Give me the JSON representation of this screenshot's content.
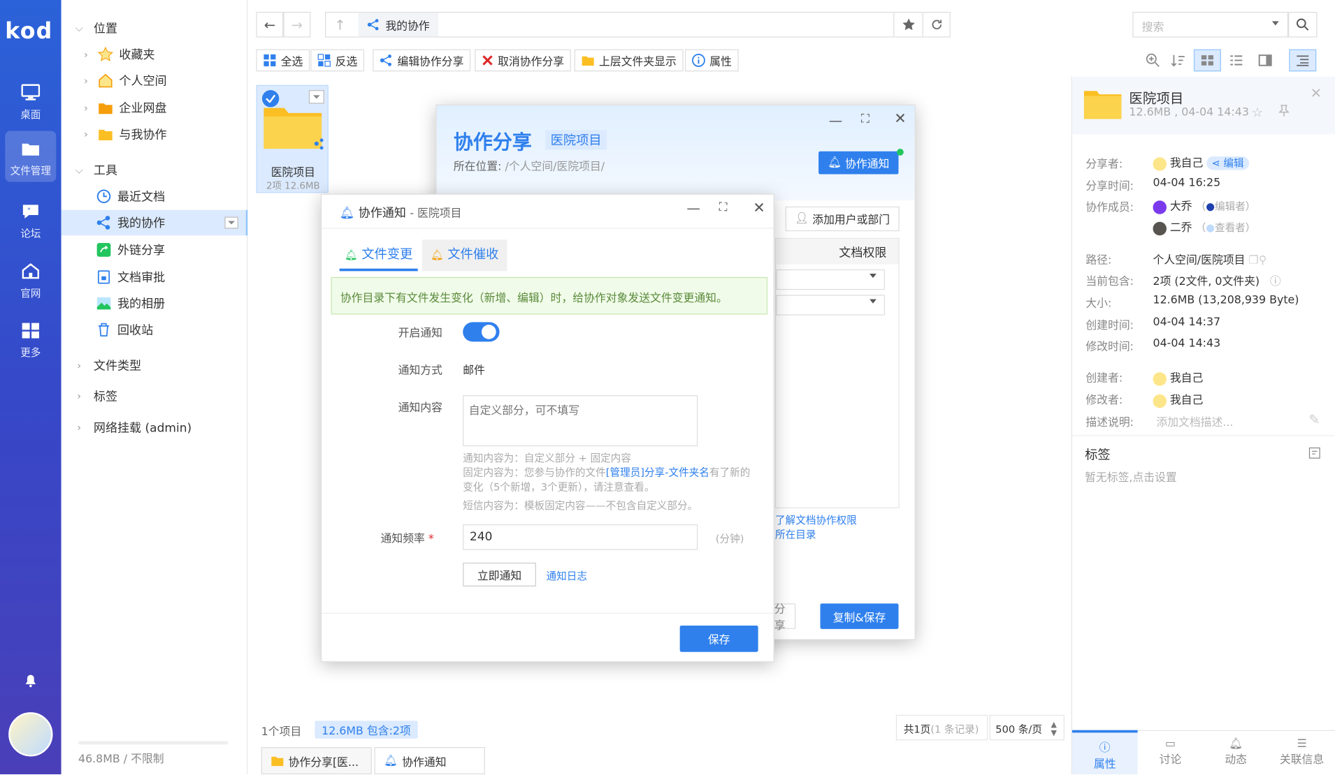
{
  "app": {
    "logo": "kod"
  },
  "rail": {
    "items": [
      {
        "label": "桌面",
        "icon": "desktop-icon"
      },
      {
        "label": "文件管理",
        "icon": "folder-icon"
      },
      {
        "label": "论坛",
        "icon": "forum-icon"
      },
      {
        "label": "官网",
        "icon": "home-icon"
      },
      {
        "label": "更多",
        "icon": "grid-icon"
      }
    ]
  },
  "tree": {
    "location_header": "位置",
    "location_items": [
      "收藏夹",
      "个人空间",
      "企业网盘",
      "与我协作"
    ],
    "tools_header": "工具",
    "tools_items": [
      "最近文档",
      "我的协作",
      "外链分享",
      "文档审批",
      "我的相册",
      "回收站"
    ],
    "filetype_header": "文件类型",
    "tags_header": "标签",
    "network_header": "网络挂载 (admin)",
    "quota": "46.8MB / 不限制"
  },
  "addressbar": {
    "breadcrumb": "我的协作",
    "search_placeholder": "搜索"
  },
  "toolbar": {
    "select_all": "全选",
    "invert": "反选",
    "edit_share": "编辑协作分享",
    "cancel_share": "取消协作分享",
    "show_parent": "上层文件夹显示",
    "props": "属性"
  },
  "file": {
    "name": "医院项目",
    "meta": "2项  12.6MB"
  },
  "share_dialog": {
    "title": "协作分享",
    "tag": "医院项目",
    "location_label": "所在位置:",
    "location_value": "/个人空间/医院项目/",
    "notify_button": "协作通知",
    "add_user_button": "添加用户或部门",
    "perm_header": "文档权限",
    "link_learn": "了解文档协作权限",
    "link_dir": "所在目录",
    "cancel_share_partial": "分享",
    "copy_save_button": "复制&保存"
  },
  "notify_dialog": {
    "title": "协作通知",
    "subtitle": "- 医院项目",
    "tab_change": "文件变更",
    "tab_remind": "文件催收",
    "info": "协作目录下有文件发生变化（新增、编辑）时，给协作对象发送文件变更通知。",
    "enable_label": "开启通知",
    "method_label": "通知方式",
    "method_value": "邮件",
    "content_label": "通知内容",
    "content_placeholder": "自定义部分，可不填写",
    "hint1": "通知内容为：自定义部分 + 固定内容",
    "hint2_pre": "固定内容为：您参与协作的文件",
    "hint2_link": "[管理员]分享-文件夹名",
    "hint2_post": "有了新的",
    "hint3": "变化（5个新增，3个更新），请注意查看。",
    "hint4": "短信内容为：模板固定内容——不包含自定义部分。",
    "freq_label": "通知频率",
    "freq_required": "*",
    "freq_value": "240",
    "freq_unit": "(分钟)",
    "notify_now_button": "立即通知",
    "notify_log_link": "通知日志",
    "save_button": "保存"
  },
  "statusbar": {
    "count": "1个项目",
    "size_badge": "12.6MB 包含:2项",
    "pages_pre": "共1页",
    "pages_records": "(1 条记录)",
    "per_page": "500 条/页"
  },
  "taskbar": {
    "tab1": "协作分享[医...",
    "tab2": "协作通知"
  },
  "props": {
    "name": "医院项目",
    "meta": "12.6MB , 04-04 14:43",
    "sharer_label": "分享者:",
    "sharer_value": "我自己",
    "sharer_badge": "编辑",
    "share_time_label": "分享时间:",
    "share_time_value": "04-04 16:25",
    "members_label": "协作成员:",
    "member1": "大乔",
    "member1_role": "编辑者",
    "member2": "二乔",
    "member2_role": "查看者",
    "path_label": "路径:",
    "path_value": "个人空间/医院项目",
    "contains_label": "当前包含:",
    "contains_value": "2项 (2文件, 0文件夹)",
    "size_label": "大小:",
    "size_value": "12.6MB (13,208,939 Byte)",
    "created_label": "创建时间:",
    "created_value": "04-04 14:37",
    "modified_label": "修改时间:",
    "modified_value": "04-04 14:43",
    "creator_label": "创建者:",
    "creator_value": "我自己",
    "modifier_label": "修改者:",
    "modifier_value": "我自己",
    "desc_label": "描述说明:",
    "desc_placeholder": "添加文档描述...",
    "tags_title": "标签",
    "tags_empty": "暂无标签,点击设置",
    "tabs": [
      "属性",
      "讨论",
      "动态",
      "关联信息"
    ]
  },
  "colors": {
    "accent": "#2f80ed",
    "rail": "#2b62d9"
  }
}
